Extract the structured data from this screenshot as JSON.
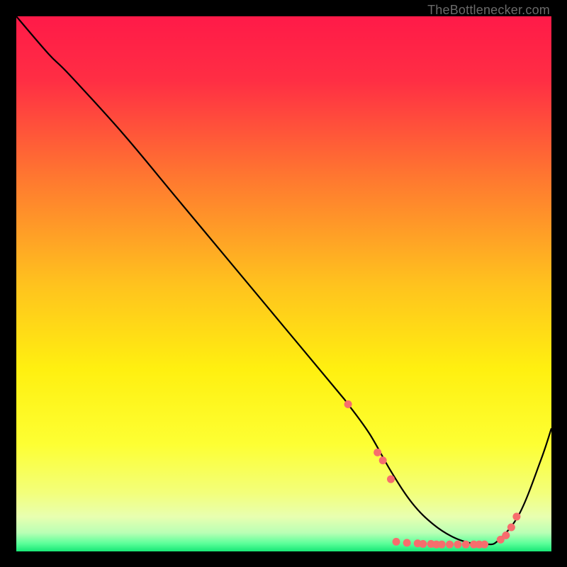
{
  "attribution": "TheBottlenecker.com",
  "chart_data": {
    "type": "line",
    "title": "",
    "xlabel": "",
    "ylabel": "",
    "xlim": [
      0,
      100
    ],
    "ylim": [
      0,
      100
    ],
    "background_gradient": {
      "stops": [
        {
          "offset": 0.0,
          "color": "#ff1a48"
        },
        {
          "offset": 0.12,
          "color": "#ff2e44"
        },
        {
          "offset": 0.3,
          "color": "#ff7730"
        },
        {
          "offset": 0.5,
          "color": "#ffc21e"
        },
        {
          "offset": 0.66,
          "color": "#fff010"
        },
        {
          "offset": 0.8,
          "color": "#fdff33"
        },
        {
          "offset": 0.89,
          "color": "#f3ff7a"
        },
        {
          "offset": 0.935,
          "color": "#e8ffb0"
        },
        {
          "offset": 0.965,
          "color": "#baffb5"
        },
        {
          "offset": 0.985,
          "color": "#5cff9a"
        },
        {
          "offset": 1.0,
          "color": "#18e876"
        }
      ]
    },
    "series": [
      {
        "name": "bottleneck-curve",
        "color": "#000000",
        "x": [
          0,
          6,
          10,
          20,
          30,
          40,
          50,
          60,
          62,
          66,
          70,
          74,
          78,
          82,
          86,
          88,
          90,
          94,
          98,
          100
        ],
        "y": [
          100,
          93,
          89,
          78,
          66,
          54,
          42,
          30,
          27.5,
          22,
          15,
          9,
          5,
          2.5,
          1.3,
          1.3,
          2.0,
          7,
          17,
          23
        ]
      }
    ],
    "markers": {
      "name": "bottleneck-dots",
      "color": "#f76d6d",
      "radius": 5.5,
      "points": [
        {
          "x": 62.0,
          "y": 27.5
        },
        {
          "x": 67.5,
          "y": 18.5
        },
        {
          "x": 68.5,
          "y": 17.0
        },
        {
          "x": 70.0,
          "y": 13.5
        },
        {
          "x": 71.0,
          "y": 1.8
        },
        {
          "x": 73.0,
          "y": 1.6
        },
        {
          "x": 75.0,
          "y": 1.5
        },
        {
          "x": 76.0,
          "y": 1.4
        },
        {
          "x": 77.5,
          "y": 1.4
        },
        {
          "x": 78.5,
          "y": 1.3
        },
        {
          "x": 79.5,
          "y": 1.3
        },
        {
          "x": 81.0,
          "y": 1.3
        },
        {
          "x": 82.5,
          "y": 1.3
        },
        {
          "x": 84.0,
          "y": 1.3
        },
        {
          "x": 85.5,
          "y": 1.3
        },
        {
          "x": 86.5,
          "y": 1.3
        },
        {
          "x": 87.5,
          "y": 1.3
        },
        {
          "x": 90.5,
          "y": 2.2
        },
        {
          "x": 91.5,
          "y": 3.0
        },
        {
          "x": 92.5,
          "y": 4.5
        },
        {
          "x": 93.5,
          "y": 6.5
        }
      ]
    }
  }
}
